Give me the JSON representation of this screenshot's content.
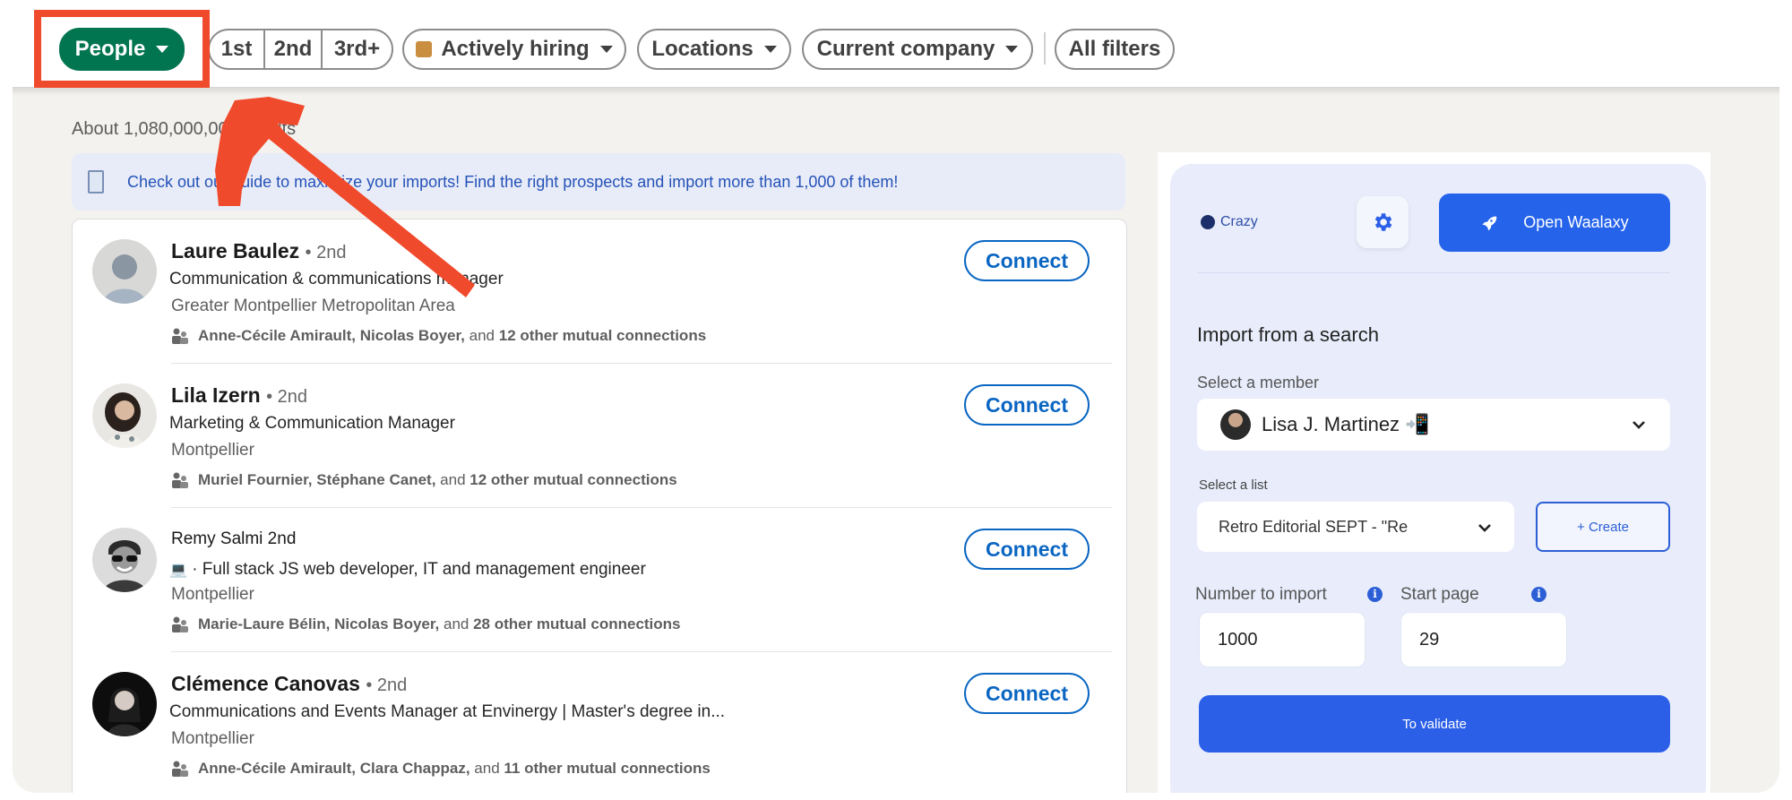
{
  "filters": {
    "people": "People",
    "degrees": [
      "1st",
      "2nd",
      "3rd+"
    ],
    "actively_hiring": "Actively hiring",
    "locations": "Locations",
    "current_company": "Current company",
    "all_filters": "All filters"
  },
  "results": {
    "count_text": "About 1,080,000,000 results",
    "guide_banner": "Check out our guide to maximize your imports! Find the right prospects and import more than 1,000 of them!",
    "connect_label": "Connect",
    "people": [
      {
        "name": "Laure Baulez",
        "degree": "• 2nd",
        "headline": "Communication & communications manager",
        "location": "Greater Montpellier Metropolitan Area",
        "mutual_names": "Anne-Cécile Amirault, Nicolas Boyer,",
        "mutual_and": " and ",
        "mutual_count": "12 other mutual connections"
      },
      {
        "name": "Lila Izern",
        "degree": "• 2nd",
        "headline": "Marketing & Communication Manager",
        "location": "Montpellier",
        "mutual_names": "Muriel Fournier, Stéphane Canet,",
        "mutual_and": " and ",
        "mutual_count": "12 other mutual connections"
      },
      {
        "name": "Remy Salmi 2nd",
        "degree": "",
        "headline": "· Full stack JS web developer, IT and management engineer",
        "location": "Montpellier",
        "mutual_names": "Marie-Laure Bélin, Nicolas Boyer,",
        "mutual_and": " and ",
        "mutual_count": "28 other mutual connections"
      },
      {
        "name": "Clémence Canovas",
        "degree": "• 2nd",
        "headline": "Communications and Events Manager at Envinergy | Master's degree in...",
        "location": "Montpellier",
        "mutual_names": "Anne-Cécile Amirault, Clara Chappaz,",
        "mutual_and": " and ",
        "mutual_count": "11 other mutual connections"
      }
    ]
  },
  "panel": {
    "brand": "Crazy",
    "open_button": "Open Waalaxy",
    "import_title": "Import from a search",
    "member_label": "Select a member",
    "member_name": "Lisa J. Martinez 📲",
    "list_label": "Select a list",
    "list_name": "Retro Editorial SEPT - \"Re",
    "create_button": "+ Create",
    "number_label": "Number to import",
    "start_label": "Start page",
    "number_value": "1000",
    "start_value": "29",
    "validate_button": "To validate"
  },
  "colors": {
    "linkedin_green": "#01754f",
    "linkedin_blue": "#0a66c2",
    "waalaxy_blue": "#2563eb",
    "annotation_red": "#f04a2c"
  }
}
